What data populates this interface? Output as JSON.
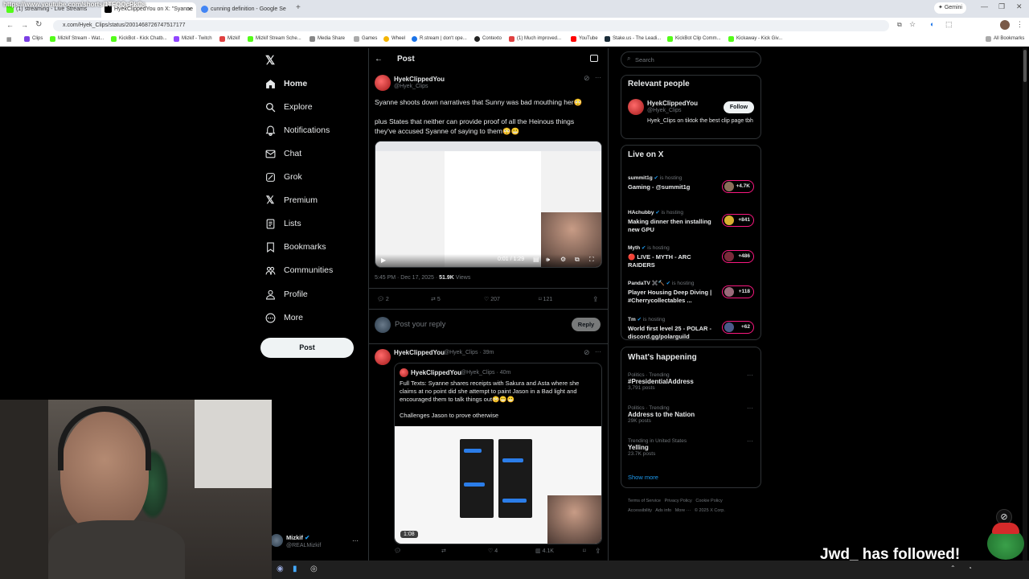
{
  "browser": {
    "tabs": [
      {
        "label": "(1) streaming - Live Streams"
      },
      {
        "label": "HyekClippedYou on X: \"Syanne"
      },
      {
        "label": "cunning definition - Google Se"
      }
    ],
    "gemini_label": "Gemini",
    "url": "x.com/Hyek_Clips/status/2001468726747517177",
    "overlay_url": "https://www.youtube.com/shorts/1TFOQcPkCs",
    "bookmarks": [
      "Clips",
      "Mizkif Stream - Wat...",
      "KickBot - Kick Chatb...",
      "Mizkif - Twitch",
      "Mizkif",
      "Mizkif Stream Sche...",
      "Media Share",
      "Games",
      "Wheel",
      "R.stream | don't ope...",
      "Contexto",
      "(1) Much improved...",
      "YouTube",
      "Stake.us - The Leadi...",
      "KickBot Clip Comm...",
      "Kickaway - Kick Giv..."
    ],
    "all_bookmarks": "All Bookmarks"
  },
  "nav": {
    "items": [
      "Home",
      "Explore",
      "Notifications",
      "Chat",
      "Grok",
      "Premium",
      "Lists",
      "Bookmarks",
      "Communities",
      "Profile",
      "More"
    ],
    "post_button": "Post",
    "account_name": "Mizkif",
    "account_handle": "@REALMizkif"
  },
  "main": {
    "header": "Post",
    "tweet": {
      "name": "HyekClippedYou",
      "handle": "@Hyek_Clips",
      "text1": "Syanne shoots down narratives that Sunny was bad mouthing her😳",
      "text2": "plus States that neither can provide proof of all the Heinous things they've accused Syanne of saying to them😳😬",
      "video_time": "0:01 / 1:29",
      "time": "5:45 PM · Dec 17, 2025 · ",
      "views_count": "51.9K",
      "views_label": " Views",
      "replies": "2",
      "reposts": "5",
      "likes": "207",
      "bookmarks": "121"
    },
    "reply_placeholder": "Post your reply",
    "reply_button": "Reply",
    "tweet2": {
      "name": "HyekClippedYou",
      "handle": "@Hyek_Clips · 39m",
      "quote_name": "HyekClippedYou",
      "quote_handle": "@Hyek_Clips · 40m",
      "quote_text1": "Full Texts: Syanne shares receipts with Sakura and Asta where she claims at no point did she attempt to paint Jason in a Bad light and encouraged them to talk things out😳😬😬",
      "quote_text2": "Challenges Jason to prove otherwise",
      "video_duration": "1:08",
      "likes": "4",
      "views": "4.1K"
    }
  },
  "right": {
    "search_placeholder": "Search",
    "relevant_title": "Relevant people",
    "relevant": {
      "name": "HyekClippedYou",
      "handle": "@Hyek_Clips",
      "bio": "Hyek_Clips on tiktok the best clip page tbh",
      "follow": "Follow"
    },
    "live_title": "Live on X",
    "live": [
      {
        "host": "summit1g",
        "hosting": "is hosting",
        "title": "Gaming - @summit1g",
        "count": "+4.7K"
      },
      {
        "host": "HAchubby",
        "hosting": "is hosting",
        "title": "Making dinner then installing new GPU",
        "count": "+841"
      },
      {
        "host": "Myth",
        "hosting": "is hosting",
        "title": "🔴 LIVE - MYTH - ARC RAIDERS",
        "count": "+486"
      },
      {
        "host": "PandaTV ✖️🔨",
        "hosting": "is hosting",
        "title": "Player Housing Deep Diving | #Cherrycollectables ...",
        "count": "+118"
      },
      {
        "host": "Tm",
        "hosting": "is hosting",
        "title": "World first level 25 - POLAR - discord.gg/polarguild",
        "count": "+62"
      }
    ],
    "happening_title": "What's happening",
    "trends": [
      {
        "meta": "Politics · Trending",
        "name": "#PresidentialAddress",
        "posts": "3,791 posts"
      },
      {
        "meta": "Politics · Trending",
        "name": "Address to the Nation",
        "posts": "29K posts"
      },
      {
        "meta": "Trending in United States",
        "name": "Yelling",
        "posts": "23.7K posts"
      }
    ],
    "show_more": "Show more",
    "footer": [
      "Terms of Service",
      "Privacy Policy",
      "Cookie Policy",
      "Accessibility",
      "Ads info",
      "More ···",
      "© 2025 X Corp."
    ]
  },
  "overlay": {
    "followed_text": "Jwd_ has followed!"
  }
}
